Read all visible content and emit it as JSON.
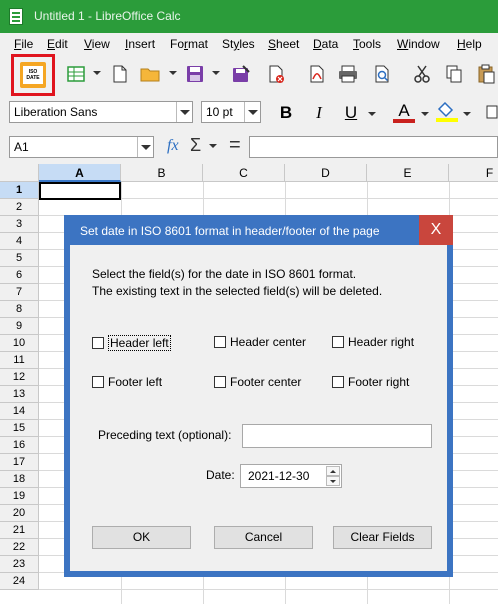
{
  "window": {
    "title": "Untitled 1 - LibreOffice Calc",
    "accent_color": "#2b9c3a"
  },
  "menu": {
    "items": [
      {
        "label": "File",
        "key": "F",
        "rest": "ile"
      },
      {
        "label": "Edit",
        "key": "E",
        "rest": "dit"
      },
      {
        "label": "View",
        "key": "V",
        "rest": "iew"
      },
      {
        "label": "Insert",
        "key": "I",
        "rest": "nsert"
      },
      {
        "label": "Format",
        "key": "r",
        "pre": "Fo",
        "rest": "mat"
      },
      {
        "label": "Styles",
        "key": "y",
        "pre": "St",
        "rest": "les"
      },
      {
        "label": "Sheet",
        "key": "S",
        "rest": "heet"
      },
      {
        "label": "Data",
        "key": "D",
        "rest": "ata"
      },
      {
        "label": "Tools",
        "key": "T",
        "rest": "ools"
      },
      {
        "label": "Window",
        "key": "W",
        "rest": "indow"
      },
      {
        "label": "Help",
        "key": "H",
        "rest": "elp"
      }
    ]
  },
  "toolbar": {
    "iso_button": {
      "line1": "ISO",
      "line2": "DATE",
      "highlight_color": "#e0141e"
    },
    "font_name": "Liberation Sans",
    "font_size": "10 pt",
    "bold": "B",
    "italic": "I",
    "underline": "U",
    "font_color_letter": "A"
  },
  "formula_bar": {
    "cell_ref": "A1",
    "fx": "fx",
    "sum": "Σ",
    "equals": "="
  },
  "sheet": {
    "columns": [
      "A",
      "B",
      "C",
      "D",
      "E",
      "F"
    ],
    "active_column": "A",
    "rows": [
      "1",
      "2",
      "3",
      "4",
      "5",
      "6",
      "7",
      "8",
      "9",
      "10",
      "11",
      "12",
      "13",
      "14",
      "15",
      "16",
      "17",
      "18",
      "19",
      "20",
      "21",
      "22",
      "23",
      "24"
    ],
    "active_row": "1"
  },
  "dialog": {
    "title": "Set date in ISO 8601 format in header/footer of the page",
    "close": "X",
    "intro_line1": "Select the field(s) for the date in ISO 8601 format.",
    "intro_line2": "The existing text in the selected field(s) will be deleted.",
    "checkboxes": {
      "header_left": {
        "label": "Header left",
        "checked": false
      },
      "header_center": {
        "label": "Header center",
        "checked": false
      },
      "header_right": {
        "label": "Header right",
        "checked": false
      },
      "footer_left": {
        "label": "Footer left",
        "checked": false
      },
      "footer_center": {
        "label": "Footer center",
        "checked": false
      },
      "footer_right": {
        "label": "Footer right",
        "checked": false
      }
    },
    "preceding_text_label": "Preceding text (optional):",
    "preceding_text_value": "",
    "date_label": "Date:",
    "date_value": "2021-12-30",
    "buttons": {
      "ok": "OK",
      "cancel": "Cancel",
      "clear": "Clear Fields"
    }
  }
}
